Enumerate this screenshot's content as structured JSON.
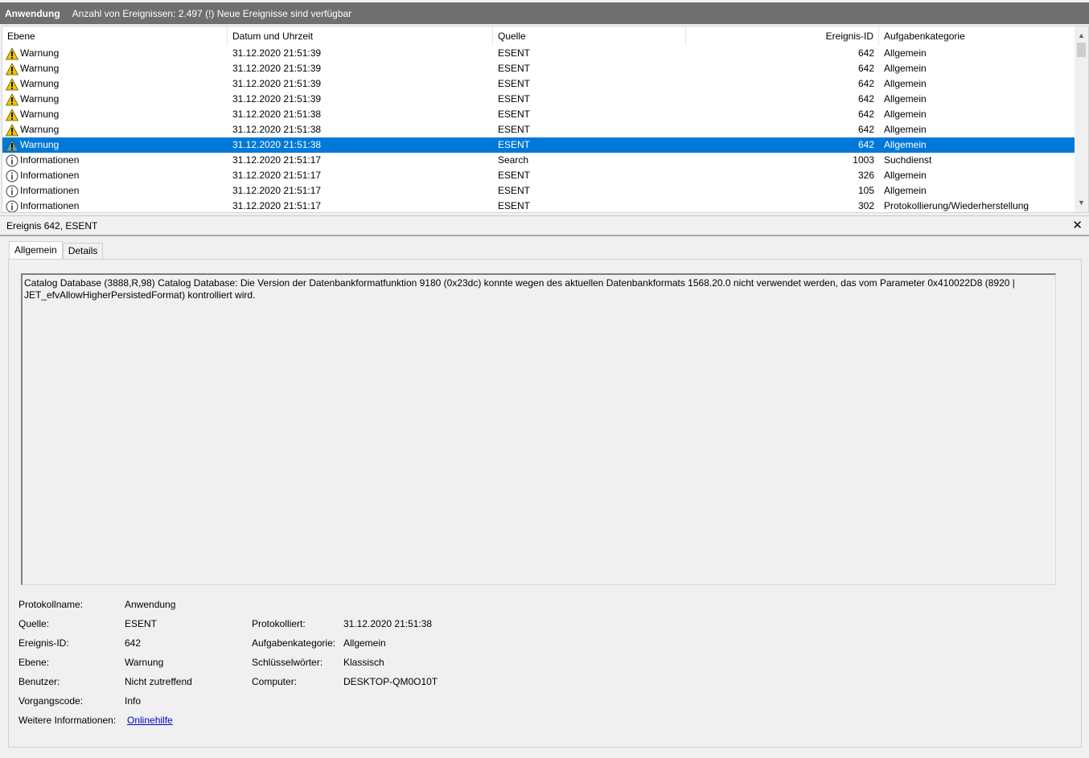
{
  "titlebar": {
    "title": "Anwendung",
    "info": "Anzahl von Ereignissen: 2.497 (!) Neue Ereignisse sind verfügbar"
  },
  "list": {
    "columns": {
      "level": "Ebene",
      "date": "Datum und Uhrzeit",
      "source": "Quelle",
      "id": "Ereignis-ID",
      "category": "Aufgabenkategorie"
    },
    "rows": [
      {
        "level": "Warnung",
        "icon": "warning-icon",
        "date": "31.12.2020 21:51:39",
        "source": "ESENT",
        "id": "642",
        "category": "Allgemein"
      },
      {
        "level": "Warnung",
        "icon": "warning-icon",
        "date": "31.12.2020 21:51:39",
        "source": "ESENT",
        "id": "642",
        "category": "Allgemein"
      },
      {
        "level": "Warnung",
        "icon": "warning-icon",
        "date": "31.12.2020 21:51:39",
        "source": "ESENT",
        "id": "642",
        "category": "Allgemein"
      },
      {
        "level": "Warnung",
        "icon": "warning-icon",
        "date": "31.12.2020 21:51:39",
        "source": "ESENT",
        "id": "642",
        "category": "Allgemein"
      },
      {
        "level": "Warnung",
        "icon": "warning-icon",
        "date": "31.12.2020 21:51:38",
        "source": "ESENT",
        "id": "642",
        "category": "Allgemein"
      },
      {
        "level": "Warnung",
        "icon": "warning-icon",
        "date": "31.12.2020 21:51:38",
        "source": "ESENT",
        "id": "642",
        "category": "Allgemein"
      },
      {
        "level": "Warnung",
        "icon": "warning-icon",
        "date": "31.12.2020 21:51:38",
        "source": "ESENT",
        "id": "642",
        "category": "Allgemein"
      },
      {
        "level": "Informationen",
        "icon": "info-icon",
        "date": "31.12.2020 21:51:17",
        "source": "Search",
        "id": "1003",
        "category": "Suchdienst"
      },
      {
        "level": "Informationen",
        "icon": "info-icon",
        "date": "31.12.2020 21:51:17",
        "source": "ESENT",
        "id": "326",
        "category": "Allgemein"
      },
      {
        "level": "Informationen",
        "icon": "info-icon",
        "date": "31.12.2020 21:51:17",
        "source": "ESENT",
        "id": "105",
        "category": "Allgemein"
      },
      {
        "level": "Informationen",
        "icon": "info-icon",
        "date": "31.12.2020 21:51:17",
        "source": "ESENT",
        "id": "302",
        "category": "Protokollierung/Wiederherstellung"
      }
    ],
    "selected_row_index": 6,
    "selection_color": "#0078d7"
  },
  "detail": {
    "header": "Ereignis 642, ESENT",
    "close_glyph": "✕",
    "tabs": [
      "Allgemein",
      "Details"
    ],
    "active_tab": "Allgemein",
    "message": "Catalog Database (3888,R,98) Catalog Database: Die Version der Datenbankformatfunktion 9180 (0x23dc) konnte wegen des aktuellen Datenbankformats 1568.20.0 nicht verwendet werden, das vom Parameter 0x410022D8 (8920 | JET_efvAllowHigherPersistedFormat) kontrolliert wird.",
    "props": {
      "logname_label": "Protokollname:",
      "logname_value": "Anwendung",
      "source_label": "Quelle:",
      "source_value": "ESENT",
      "logged_label": "Protokolliert:",
      "logged_value": "31.12.2020 21:51:38",
      "id_label": "Ereignis-ID:",
      "id_value": "642",
      "category_label": "Aufgabenkategorie:",
      "category_value": "Allgemein",
      "level_label": "Ebene:",
      "level_value": "Warnung",
      "keywords_label": "Schlüsselwörter:",
      "keywords_value": "Klassisch",
      "user_label": "Benutzer:",
      "user_value": "Nicht zutreffend",
      "computer_label": "Computer:",
      "computer_value": "DESKTOP-QM0O10T",
      "opcode_label": "Vorgangscode:",
      "opcode_value": "Info",
      "moreinfo_label": "Weitere Informationen:",
      "moreinfo_link": "Onlinehilfe"
    }
  }
}
